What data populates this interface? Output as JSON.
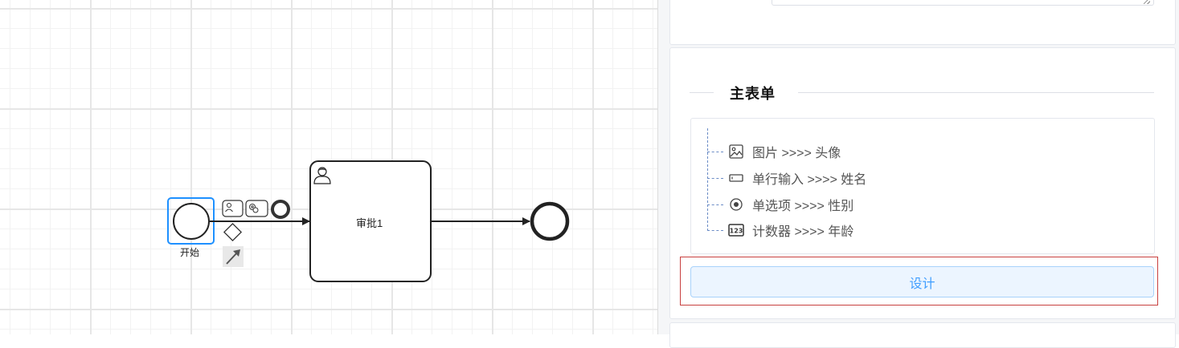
{
  "diagram": {
    "start_event_label": "开始",
    "user_task_label": "审批1"
  },
  "panel": {
    "section_title": "主表单",
    "form_fields": [
      {
        "icon": "image-icon",
        "text": "图片 >>>> 头像"
      },
      {
        "icon": "single-line-input-icon",
        "text": "单行输入 >>>> 姓名"
      },
      {
        "icon": "radio-icon",
        "text": "单选项 >>>> 性别"
      },
      {
        "icon": "counter-icon",
        "text": "计数器 >>>> 年龄"
      }
    ],
    "design_button_label": "设计"
  },
  "colors": {
    "selection_blue": "#1e90ff",
    "button_text": "#409eff",
    "button_bg": "#ecf5ff",
    "highlight_red": "#c8403f",
    "tree_line": "#6b8cc6"
  }
}
